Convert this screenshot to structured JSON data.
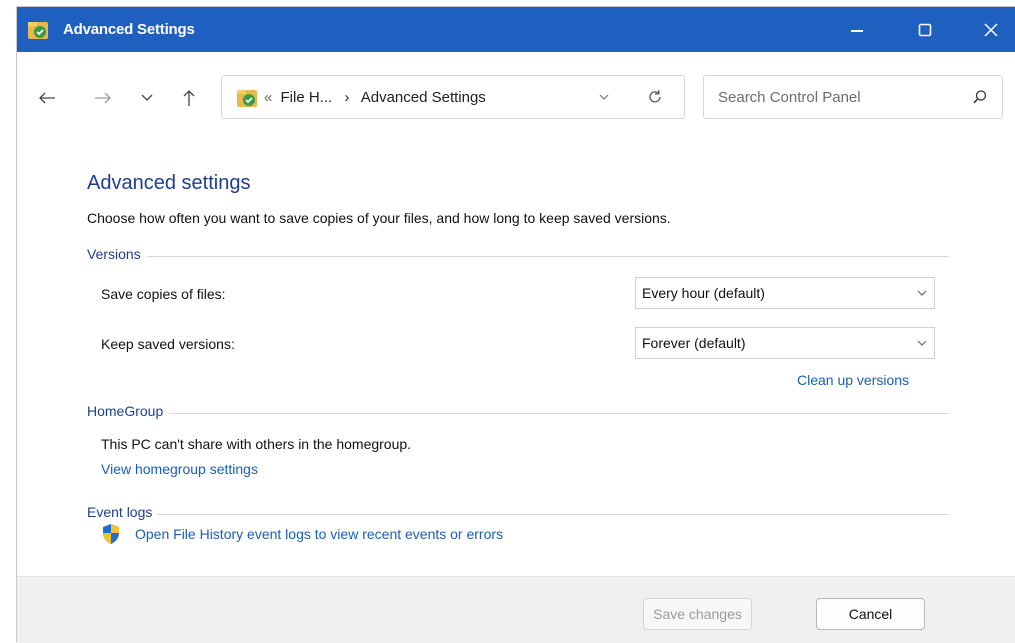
{
  "window": {
    "title": "Advanced Settings",
    "accent_color": "#1f5fbf"
  },
  "nav": {
    "back": "back-arrow",
    "forward": "forward-arrow",
    "recent": "chevron-down",
    "up": "up-arrow"
  },
  "address": {
    "prefix": "«",
    "crumb_parent": "File H...",
    "separator": "›",
    "crumb_current": "Advanced Settings"
  },
  "search": {
    "placeholder": "Search Control Panel"
  },
  "page": {
    "heading": "Advanced settings",
    "description": "Choose how often you want to save copies of your files, and how long to keep saved versions."
  },
  "versions": {
    "section_title": "Versions",
    "save_copies_label": "Save copies of files:",
    "save_copies_value": "Every hour (default)",
    "keep_versions_label": "Keep saved versions:",
    "keep_versions_value": "Forever (default)",
    "cleanup_link": "Clean up versions"
  },
  "homegroup": {
    "section_title": "HomeGroup",
    "message": "This PC can't share with others in the homegroup.",
    "settings_link": "View homegroup settings"
  },
  "event_logs": {
    "section_title": "Event logs",
    "open_link": "Open File History event logs to view recent events or errors"
  },
  "footer": {
    "save_label": "Save changes",
    "cancel_label": "Cancel"
  }
}
